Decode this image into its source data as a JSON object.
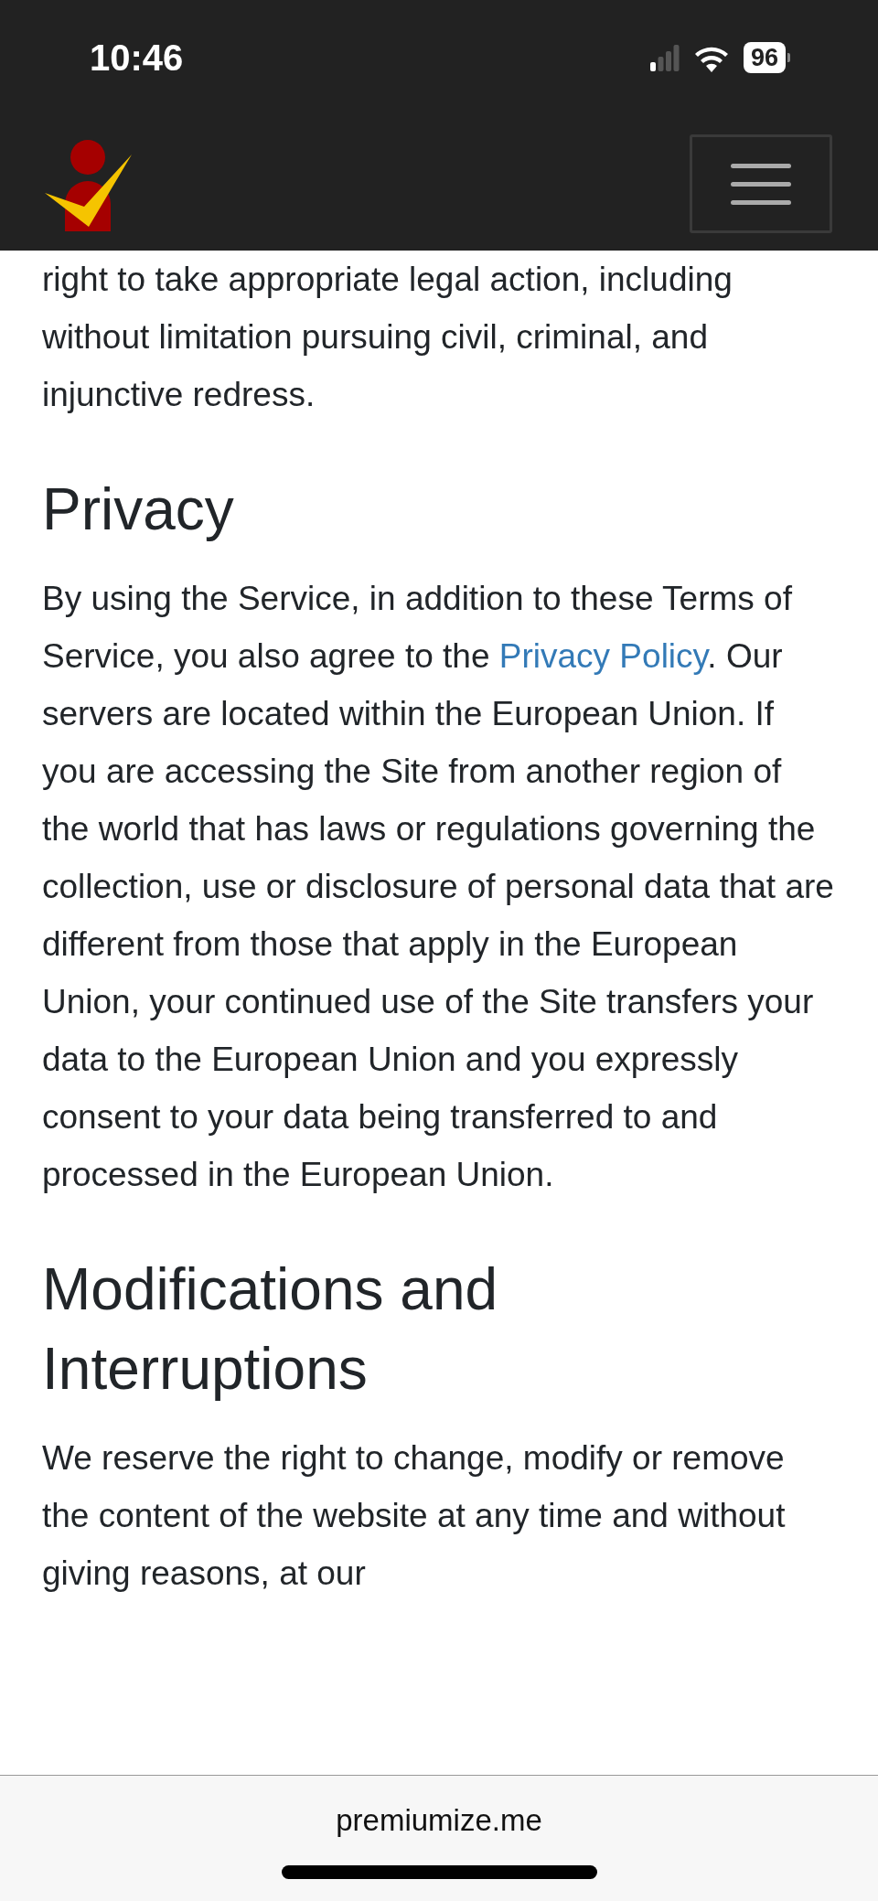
{
  "status_bar": {
    "time": "10:46",
    "battery": "96"
  },
  "content": [
    {
      "kind": "paragraph",
      "segments": [
        {
          "kind": "text",
          "text": "right to take appropriate legal action, including without limitation pursuing civil, criminal, and injunctive redress."
        }
      ]
    },
    {
      "kind": "heading",
      "text": "Privacy"
    },
    {
      "kind": "paragraph",
      "segments": [
        {
          "kind": "text",
          "text": "By using the Service, in addition to these Terms of Service, you also agree to the "
        },
        {
          "kind": "link",
          "text": "Privacy Policy"
        },
        {
          "kind": "text",
          "text": ". Our servers are located within the European Union. If you are accessing the Site from another region of the world that has laws or regulations governing the collection, use or disclosure of personal data that are different from those that apply in the European Union, your continued use of the Site transfers your data to the European Union and you expressly consent to your data being transferred to and processed in the European Union."
        }
      ]
    },
    {
      "kind": "heading",
      "text": "Modifications and Interruptions"
    },
    {
      "kind": "paragraph",
      "segments": [
        {
          "kind": "text",
          "text": "We reserve the right to change, modify or remove the content of the website at any time and without giving reasons, at our"
        }
      ]
    }
  ],
  "address_bar": {
    "domain": "premiumize.me"
  }
}
